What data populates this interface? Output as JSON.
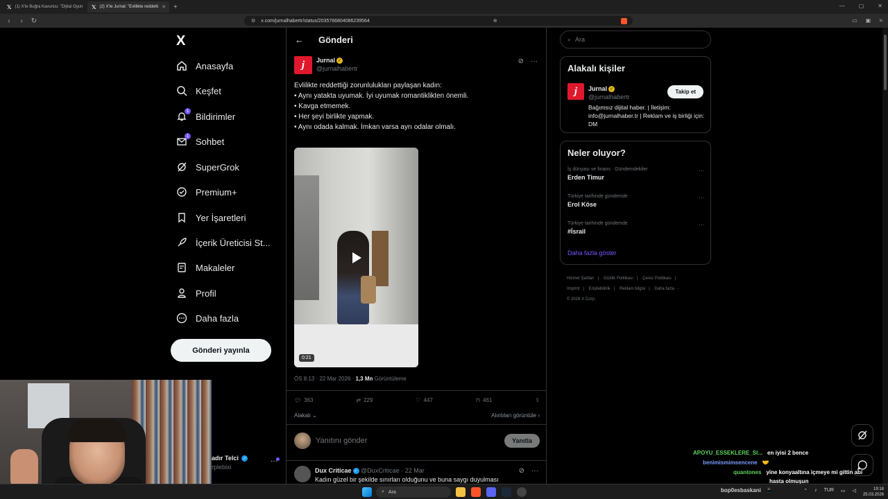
{
  "browser": {
    "tabs": [
      {
        "label": "(1) X'te Buğra Kavuncu: \"Dijital Oyun",
        "active": false
      },
      {
        "label": "(2) X'te Jurnal: \"Evlilikte reddetti",
        "active": true
      }
    ],
    "url": "x.com/jurnalhabertr/status/2035766804086239564"
  },
  "sidebar": {
    "logo": "X",
    "items": [
      {
        "label": "Anasayfa",
        "icon": "home-icon"
      },
      {
        "label": "Keşfet",
        "icon": "search-icon"
      },
      {
        "label": "Bildirimler",
        "icon": "bell-icon",
        "badge": "1"
      },
      {
        "label": "Sohbet",
        "icon": "mail-icon",
        "badge": "1"
      },
      {
        "label": "SuperGrok",
        "icon": "grok-icon"
      },
      {
        "label": "Premium+",
        "icon": "premium-icon"
      },
      {
        "label": "Yer İşaretleri",
        "icon": "bookmark-icon"
      },
      {
        "label": "İçerik Üreticisi St...",
        "icon": "rocket-icon"
      },
      {
        "label": "Makaleler",
        "icon": "article-icon"
      },
      {
        "label": "Profil",
        "icon": "person-icon"
      },
      {
        "label": "Daha fazla",
        "icon": "more-circle-icon"
      }
    ],
    "post_button": "Gönderi yayınla",
    "account": {
      "name": "adır Telci",
      "handle": "rplebixi"
    }
  },
  "main": {
    "header_title": "Gönderi",
    "tweet": {
      "display_name": "Jurnal",
      "handle": "@jurnalhabertr",
      "lines": [
        "Evlilikte reddettiği zorunlulukları paylaşan kadın:",
        "",
        "• Aynı yatakta uyumak. İyi uyumak romantiklikten önemli.",
        "• Kavga etmemek.",
        "• Her şeyi birlikte yapmak.",
        "• Aynı odada kalmak. İmkan varsa ayrı odalar olmalı."
      ],
      "video_time": "0:21",
      "timestamp": "ÖS 8:13 · 22 Mar 2026 · ",
      "views": "1,3 Mn",
      "views_label": " Görüntüleme",
      "replies": "363",
      "reposts": "229",
      "likes": "447",
      "bookmarks": "461"
    },
    "sort_label": "Alakalı",
    "quotes_link": "Alıntıları görüntüle",
    "reply_placeholder": "Yanıtını gönder",
    "reply_button": "Yanıtla",
    "next_reply": {
      "name": "Dux Criticae",
      "handle": "@DuxCriticae · 22 Mar",
      "text": "Kadın güzel bir şekilde sınırları olduğunu ve buna saygı duyulması"
    }
  },
  "right": {
    "search_placeholder": "Ara",
    "relevant": {
      "title": "Alakalı kişiler",
      "name": "Jurnal",
      "handle": "@jurnalhabertr",
      "follow": "Takip et",
      "bio": "Bağımsız dijital haber. | İletişim: info@jurnalhaber.tr | Reklam ve iş birliği için: DM"
    },
    "trends": {
      "title": "Neler oluyor?",
      "items": [
        {
          "category": "İş dünyası ve finans · Gündemdekiler",
          "topic": "Erden Timur"
        },
        {
          "category": "Türkiye tarihinde gündemde",
          "topic": "Erol Köse"
        },
        {
          "category": "Türkiye tarihinde gündemde",
          "topic": "#İsrail"
        }
      ],
      "show_more": "Daha fazla göster"
    },
    "footer": {
      "row1": [
        "Hizmet Şartları",
        "|",
        "Gizlilik Politikası",
        "|",
        "Çerez Politikası",
        "|"
      ],
      "row2": [
        "Imprint",
        "|",
        "Erişilebilirlik",
        "|",
        "Reklam bilgisi",
        "|",
        "Daha fazla ···"
      ],
      "copyright": "© 2026 X Corp."
    }
  },
  "chat": [
    {
      "user": "APOYU_ESSEKLERE_SI...",
      "msg": "en iyisi 2 bence",
      "color": "#5fd35f"
    },
    {
      "user": "benimismimsencene",
      "msg": "🤝",
      "color": "#7a9cff"
    },
    {
      "user": "quantones",
      "msg": "yine konyaaltına içmeye mi gittin abi",
      "color": "#5fd35f"
    },
    {
      "user": "",
      "msg": "hasta olmuşun",
      "color": "#ffffff"
    },
    {
      "user": "bop0esbaskani",
      "msg": "📱",
      "color": "#d0d0d0"
    }
  ],
  "taskbar": {
    "search": "Ara",
    "lang": "TUR",
    "time": "19:18",
    "date": "25.03.2026"
  }
}
